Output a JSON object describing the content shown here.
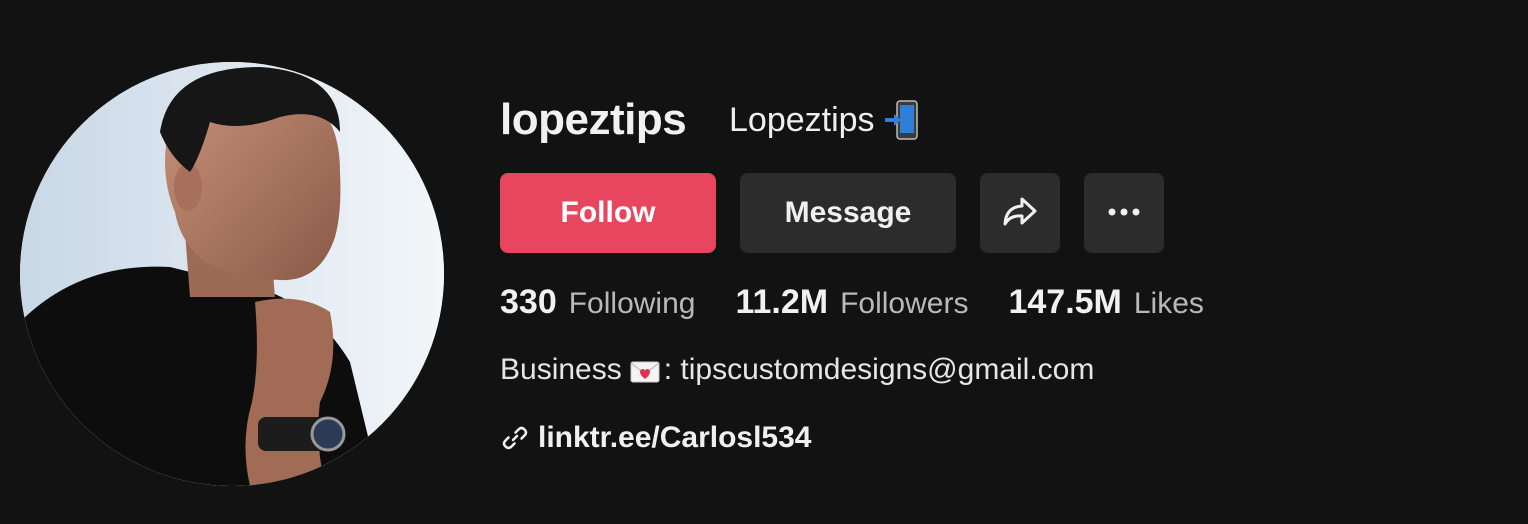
{
  "profile": {
    "username": "lopeztips",
    "nickname": "Lopeztips",
    "nickname_emoji": "mobile-phone-arrow-icon"
  },
  "actions": {
    "follow_label": "Follow",
    "message_label": "Message",
    "share_icon": "share-arrow-icon",
    "more_icon": "more-dots-icon"
  },
  "stats": {
    "following_count": "330",
    "following_label": "Following",
    "followers_count": "11.2M",
    "followers_label": "Followers",
    "likes_count": "147.5M",
    "likes_label": "Likes"
  },
  "bio": {
    "prefix": "Business",
    "emoji": "love-letter-icon",
    "suffix": ": tipscustomdesigns@gmail.com"
  },
  "link": {
    "icon": "link-icon",
    "text": "linktr.ee/Carlosl534"
  },
  "colors": {
    "background": "#121212",
    "follow_button": "#e8465e",
    "secondary_button": "#2c2c2c"
  }
}
